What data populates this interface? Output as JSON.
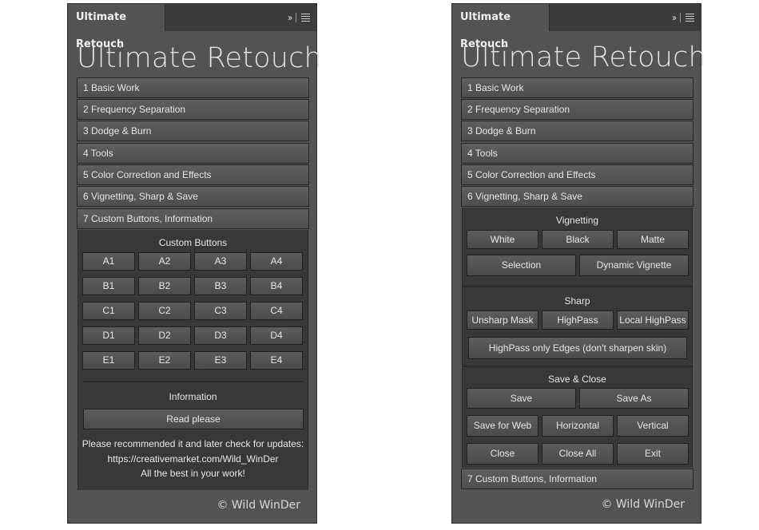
{
  "left_panel": {
    "tab_title": "Ultimate Retouch",
    "header_title": "Ultimate Retouch",
    "nav": [
      "1 Basic Work",
      "2 Frequency Separation",
      "3 Dodge & Burn",
      "4 Tools",
      "5 Color Correction and Effects",
      "6 Vignetting, Sharp & Save",
      "7 Custom Buttons, Information"
    ],
    "custom_buttons_title": "Custom Buttons",
    "custom_buttons": [
      [
        "A1",
        "A2",
        "A3",
        "A4"
      ],
      [
        "B1",
        "B2",
        "B3",
        "B4"
      ],
      [
        "C1",
        "C2",
        "C3",
        "C4"
      ],
      [
        "D1",
        "D2",
        "D3",
        "D4"
      ],
      [
        "E1",
        "E2",
        "E3",
        "E4"
      ]
    ],
    "information_title": "Information",
    "read_button": "Read please",
    "info_lines": [
      "Please recommended it and later check for updates:",
      "https://creativemarket.com/Wild_WinDer",
      "All the best in your work!"
    ],
    "copyright": "© Wild WinDer"
  },
  "right_panel": {
    "tab_title": "Ultimate Retouch",
    "header_title": "Ultimate Retouch",
    "nav": [
      "1 Basic Work",
      "2 Frequency Separation",
      "3 Dodge & Burn",
      "4 Tools",
      "5 Color Correction and Effects",
      "6 Vignetting, Sharp & Save"
    ],
    "vignetting": {
      "title": "Vignetting",
      "white": "White",
      "black": "Black",
      "matte": "Matte",
      "selection": "Selection",
      "dynamic": "Dynamic Vignette"
    },
    "sharp": {
      "title": "Sharp",
      "unsharp": "Unsharp Mask",
      "highpass": "HighPass",
      "local_highpass": "Local HighPass",
      "highpass_edges": "HighPass only Edges (don't sharpen skin)"
    },
    "save_close": {
      "title": "Save & Close",
      "save": "Save",
      "save_as": "Save As",
      "save_web": "Save for Web",
      "horizontal": "Horizontal",
      "vertical": "Vertical",
      "close": "Close",
      "close_all": "Close All",
      "exit": "Exit"
    },
    "nav_bottom": "7 Custom Buttons, Information",
    "copyright": "© Wild WinDer"
  },
  "icons": {
    "collapse": "double-chevron-right-icon",
    "menu": "hamburger-menu-icon"
  }
}
